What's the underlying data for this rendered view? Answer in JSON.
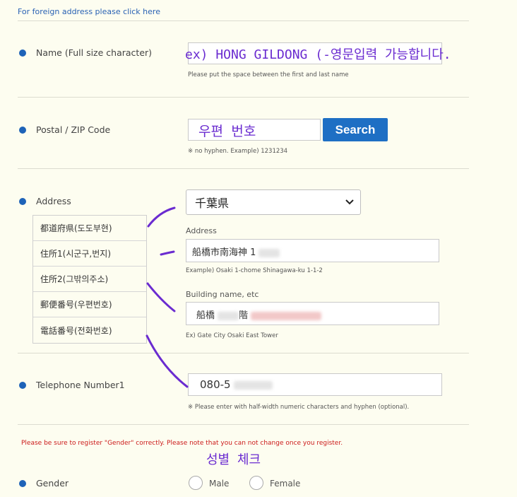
{
  "top_link": "For foreign address please click here",
  "name": {
    "label": "Name (Full size character)",
    "annotation": "ex) HONG GILDONG (-영문입력 가능합니다.",
    "hint": "Please put the space between the first and last name"
  },
  "postal": {
    "label": "Postal / ZIP Code",
    "value": "우편 번호",
    "search_label": "Search",
    "hint": "※ no hyphen. Example) 1231234"
  },
  "address": {
    "label": "Address",
    "prefecture_selected": "千葉県",
    "address_sublabel": "Address",
    "address_value": "船橋市南海神 1",
    "address_hint": "Example) Osaki 1-chome Shinagawa-ku 1-1-2",
    "building_sublabel": "Building name, etc",
    "building_value_prefix": "船橋",
    "building_value_mid": "階",
    "building_hint": "Ex) Gate City Osaki East Tower"
  },
  "overlay_rows": [
    "都道府県(도도부현)",
    "住所1(시군구,번지)",
    "住所2(그밖의주소)",
    "郵便番号(우편번호)",
    "電話番号(전화번호)"
  ],
  "telephone": {
    "label": "Telephone Number1",
    "value_prefix": "080-5",
    "hint": "※ Please enter with half-width numeric characters and hyphen (optional)."
  },
  "gender_warning": "Please be sure to register \"Gender\" correctly. Please note that you can not change once you register.",
  "gender_annotation": "성별 체크",
  "gender": {
    "label": "Gender",
    "option_male": "Male",
    "option_female": "Female"
  },
  "colors": {
    "accent": "#1e63b8",
    "annotation": "#6a2bd0",
    "warning": "#cc1a1a",
    "background": "#fdfdf0"
  }
}
